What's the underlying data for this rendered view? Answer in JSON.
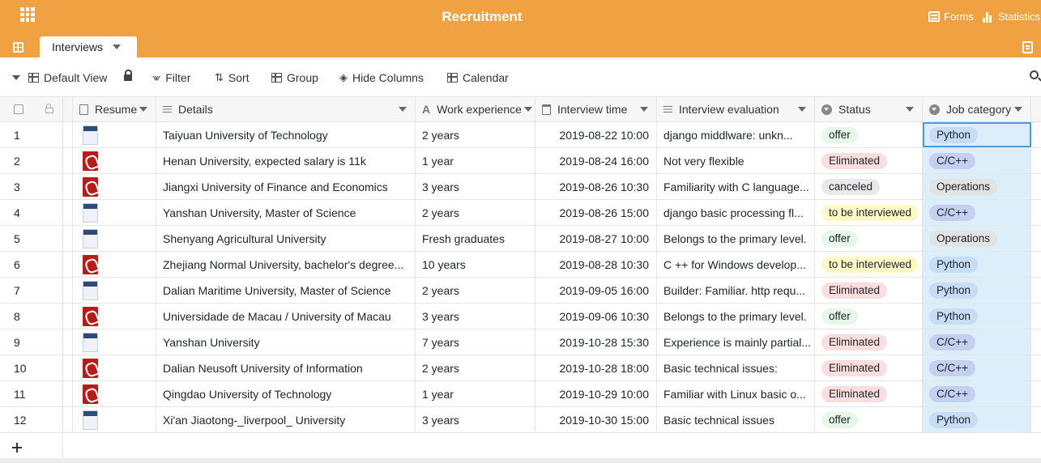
{
  "app": {
    "title": "Recruitment"
  },
  "header": {
    "forms_label": "Forms",
    "statistics_label": "Statistics"
  },
  "tabs": [
    {
      "label": "Interviews"
    }
  ],
  "toolbar": {
    "view_label": "Default View",
    "filter_label": "Filter",
    "sort_label": "Sort",
    "group_label": "Group",
    "hide_columns_label": "Hide Columns",
    "calendar_label": "Calendar"
  },
  "columns": {
    "resume": "Resume",
    "details": "Details",
    "work": "Work experience",
    "time": "Interview time",
    "eval": "Interview evaluation",
    "status": "Status",
    "job": "Job category"
  },
  "status_colors": {
    "offer": "#e6f8ea",
    "Eliminated": "#fddede",
    "canceled": "#e9e9e9",
    "to be interviewed": "#fdf8c8"
  },
  "job_colors": {
    "Python": "#c7dcf5",
    "C/C++": "#c5cff0",
    "Operations": "#e3e3e3"
  },
  "rows": [
    {
      "num": "1",
      "file": "doc",
      "details": "Taiyuan University of Technology",
      "work": "2 years",
      "time": "2019-08-22 10:00",
      "eval": "django middlware:  unkn...",
      "status": "offer",
      "job": "Python"
    },
    {
      "num": "2",
      "file": "pdf",
      "details": "Henan University, expected salary is 11k",
      "work": "1 year",
      "time": "2019-08-24 16:00",
      "eval": "Not very flexible",
      "status": "Eliminated",
      "job": "C/C++"
    },
    {
      "num": "3",
      "file": "pdf",
      "details": "Jiangxi University of Finance and Economics",
      "work": "3 years",
      "time": "2019-08-26 10:30",
      "eval": "Familiarity with C language...",
      "status": "canceled",
      "job": "Operations"
    },
    {
      "num": "4",
      "file": "doc",
      "details": "Yanshan University, Master of Science",
      "work": "2 years",
      "time": "2019-08-26 15:00",
      "eval": "django basic processing fl...",
      "status": "to be interviewed",
      "job": "C/C++"
    },
    {
      "num": "5",
      "file": "doc",
      "details": "Shenyang Agricultural University",
      "work": "Fresh graduates",
      "time": "2019-08-27 10:00",
      "eval": "Belongs to the primary level.",
      "status": "offer",
      "job": "Operations"
    },
    {
      "num": "6",
      "file": "pdf",
      "details": "Zhejiang Normal University, bachelor's degree...",
      "work": "10 years",
      "time": "2019-08-28 10:30",
      "eval": "C ++ for Windows develop...",
      "status": "to be interviewed",
      "job": "Python"
    },
    {
      "num": "7",
      "file": "doc",
      "details": "Dalian Maritime University, Master of Science",
      "work": "2 years",
      "time": "2019-09-05 16:00",
      "eval": "Builder: Familiar. http requ...",
      "status": "Eliminated",
      "job": "Python"
    },
    {
      "num": "8",
      "file": "pdf",
      "details": "Universidade de Macau / University of Macau",
      "work": "3 years",
      "time": "2019-09-06 10:30",
      "eval": "Belongs to the primary level.",
      "status": "offer",
      "job": "Python"
    },
    {
      "num": "9",
      "file": "doc",
      "details": "Yanshan University",
      "work": "7 years",
      "time": "2019-10-28 15:30",
      "eval": "Experience is mainly partial...",
      "status": "Eliminated",
      "job": "C/C++"
    },
    {
      "num": "10",
      "file": "pdf",
      "details": "Dalian Neusoft University of Information",
      "work": "2 years",
      "time": "2019-10-28 18:00",
      "eval": "Basic technical issues:",
      "status": "Eliminated",
      "job": "C/C++"
    },
    {
      "num": "11",
      "file": "pdf",
      "details": "Qingdao University of Technology",
      "work": "1 year",
      "time": "2019-10-29 10:00",
      "eval": "Familiar with Linux basic o...",
      "status": "Eliminated",
      "job": "C/C++"
    },
    {
      "num": "12",
      "file": "doc",
      "details": "Xi'an Jiaotong-_liverpool_ University",
      "work": "3 years",
      "time": "2019-10-30 15:00",
      "eval": "Basic technical issues",
      "status": "offer",
      "job": "Python"
    }
  ]
}
